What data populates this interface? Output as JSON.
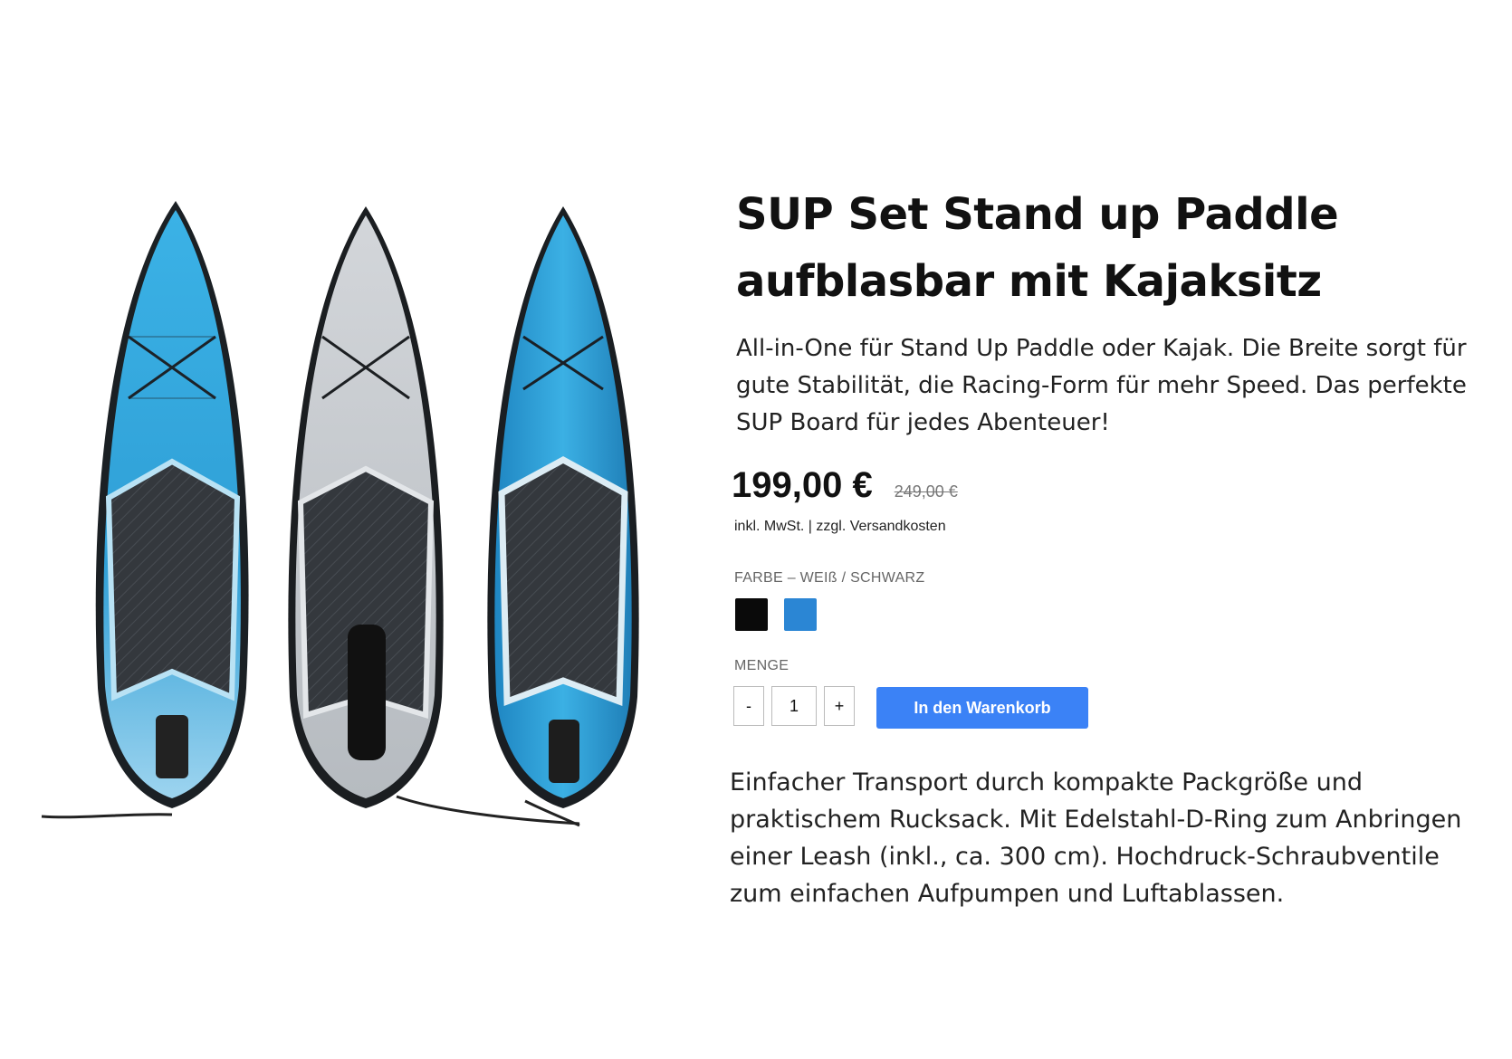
{
  "product": {
    "title": "SUP Set Stand up Paddle aufblasbar mit Kajaksitz",
    "intro": "All-in-One für Stand Up Paddle oder Kajak. Die Breite sorgt für gute Stabilität, die Racing-Form für mehr Speed. Das perfekte SUP Board für jedes Abenteuer!",
    "price": "199,00 €",
    "old_price": "249,00 €",
    "tax_note": "inkl. MwSt. | zzgl. Versandkosten",
    "color_label": "FARBE – WEIß / SCHWARZ",
    "colors": [
      {
        "name": "schwarz",
        "hex": "#0a0a0a"
      },
      {
        "name": "blau",
        "hex": "#2b86d4"
      }
    ],
    "qty_label": "MENGE",
    "qty_minus": "-",
    "qty_value": "1",
    "qty_plus": "+",
    "cart_button": "In den Warenkorb",
    "cart_color": "#3b82f6",
    "outro": "Einfacher Transport durch kompakte Packgröße und praktischem Rucksack. Mit Edelstahl-D-Ring zum Anbringen einer Leash (inkl., ca. 300 cm). Hochdruck-Schraubventile zum einfachen Aufpumpen und Luftablassen."
  },
  "gallery": {
    "boards": [
      {
        "name": "blue-board",
        "deck": "#35a8dc",
        "pad": "#2f3338"
      },
      {
        "name": "grey-board",
        "deck": "#c8ccd1",
        "pad": "#3b3e42"
      },
      {
        "name": "teal-board",
        "deck": "#2a9bd1",
        "pad": "#30343a"
      }
    ]
  }
}
